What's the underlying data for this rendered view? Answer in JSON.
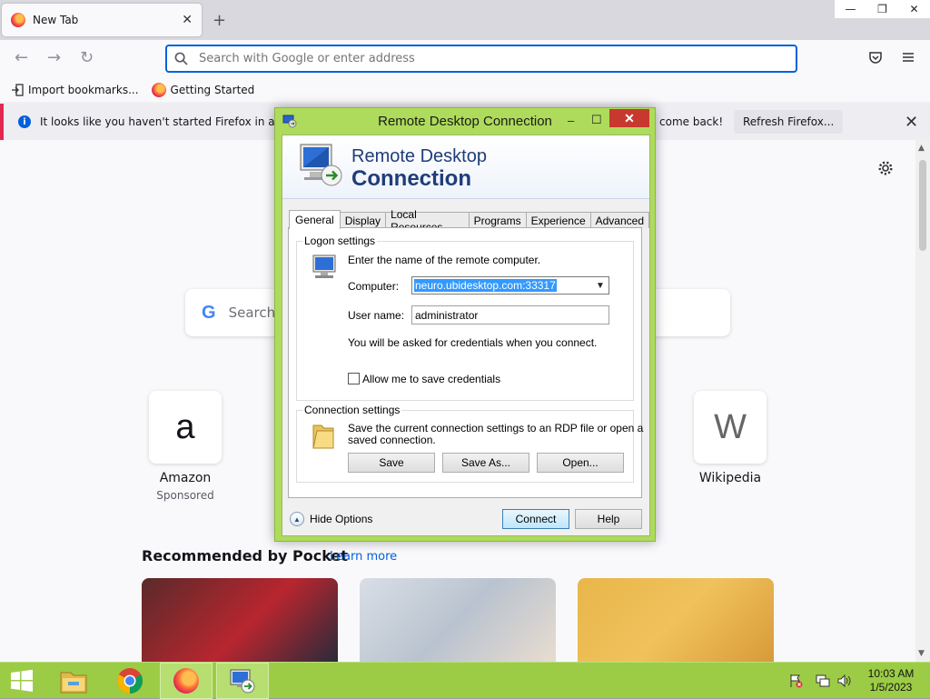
{
  "browser": {
    "tab_title": "New Tab",
    "new_tab_symbol": "+",
    "close_tab_symbol": "✕",
    "window_controls": {
      "minimize": "—",
      "restore": "❐",
      "close": "✕"
    },
    "nav": {
      "back": "←",
      "forward": "→",
      "reload": "↻"
    },
    "url_placeholder": "Search with Google or enter address",
    "bookmarks": [
      {
        "label": "Import bookmarks...",
        "icon": "import-icon"
      },
      {
        "label": "Getting Started",
        "icon": "firefox-icon"
      }
    ],
    "notice": {
      "text_left": "It looks like you haven't started Firefox in a while.",
      "text_right": "come back!",
      "refresh_label": "Refresh Firefox...",
      "close_symbol": "✕"
    },
    "new_tab_page": {
      "search_placeholder": "Search",
      "google_letter": "G",
      "top_sites": [
        {
          "label": "Amazon",
          "sublabel": "Sponsored",
          "glyph": "a"
        },
        {
          "label": "Wikipedia",
          "sublabel": "",
          "glyph": "W"
        }
      ],
      "pocket_title": "Recommended by Pocket",
      "pocket_link": "Learn more"
    }
  },
  "rdc": {
    "window_title": "Remote Desktop Connection",
    "controls": {
      "minimize": "–",
      "maximize": "☐",
      "close": "✕"
    },
    "banner_line1": "Remote Desktop",
    "banner_line2": "Connection",
    "tabs": [
      "General",
      "Display",
      "Local Resources",
      "Programs",
      "Experience",
      "Advanced"
    ],
    "active_tab": "General",
    "logon": {
      "group_label": "Logon settings",
      "instruction": "Enter the name of the remote computer.",
      "computer_label": "Computer:",
      "computer_value": "neuro.ubidesktop.com:33317",
      "username_label": "User name:",
      "username_value": "administrator",
      "credentials_note": "You will be asked for credentials when you connect.",
      "save_credentials_label": "Allow me to save credentials",
      "save_credentials_checked": false
    },
    "connection": {
      "group_label": "Connection settings",
      "description_line1": "Save the current connection settings to an RDP file or open a",
      "description_line2": "saved connection.",
      "save_label": "Save",
      "save_as_label": "Save As...",
      "open_label": "Open..."
    },
    "hide_options_label": "Hide Options",
    "connect_label": "Connect",
    "help_label": "Help"
  },
  "taskbar": {
    "clock_time": "10:03 AM",
    "clock_date": "1/5/2023",
    "pinned": [
      "windows-start-icon",
      "file-explorer-icon",
      "chrome-icon",
      "firefox-icon",
      "remote-desktop-icon"
    ]
  },
  "colors": {
    "rdc_frame": "#aedb5b",
    "taskbar": "#9ccc45",
    "close_red": "#c7392e",
    "url_focus": "#0061e0"
  }
}
